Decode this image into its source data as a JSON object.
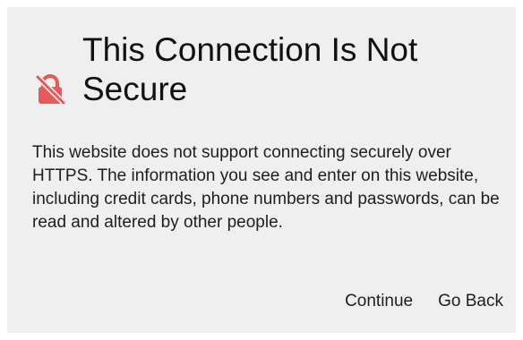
{
  "dialog": {
    "icon": "unlocked-warning-icon",
    "icon_color": "#e55b5b",
    "title": "This Connection Is Not Secure",
    "message": "This website does not support connecting securely over HTTPS. The information you see and enter on this website, including credit cards, phone numbers and passwords, can be read and altered by other people.",
    "actions": {
      "continue_label": "Continue",
      "go_back_label": "Go Back"
    }
  }
}
